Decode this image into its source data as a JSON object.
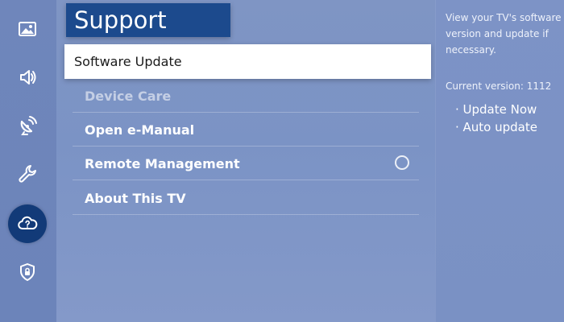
{
  "sidebar": {
    "items": [
      {
        "name": "picture",
        "icon": "picture-icon"
      },
      {
        "name": "sound",
        "icon": "speaker-icon"
      },
      {
        "name": "broadcasting",
        "icon": "satellite-dish-icon"
      },
      {
        "name": "general",
        "icon": "wrench-icon"
      },
      {
        "name": "support",
        "icon": "cloud-question-icon",
        "active": true
      },
      {
        "name": "privacy",
        "icon": "shield-lock-icon"
      }
    ]
  },
  "main": {
    "title": "Support",
    "focused_item": "Software Update",
    "items": [
      {
        "label": "Device Care",
        "state": "dimmed"
      },
      {
        "label": "Open e-Manual"
      },
      {
        "label": "Remote Management",
        "toggle": "off"
      },
      {
        "label": "About This TV"
      }
    ]
  },
  "info": {
    "description": "View your TV's software version and update if necessary.",
    "current_version": "Current version: 1112",
    "options": [
      "· Update Now",
      "· Auto update"
    ]
  },
  "colors": {
    "background": "#7b93c5",
    "sidebar": "#6c84ba",
    "title_bg": "#1c4a8d",
    "active_icon_bg": "#123a78",
    "focus_bg": "#ffffff"
  }
}
